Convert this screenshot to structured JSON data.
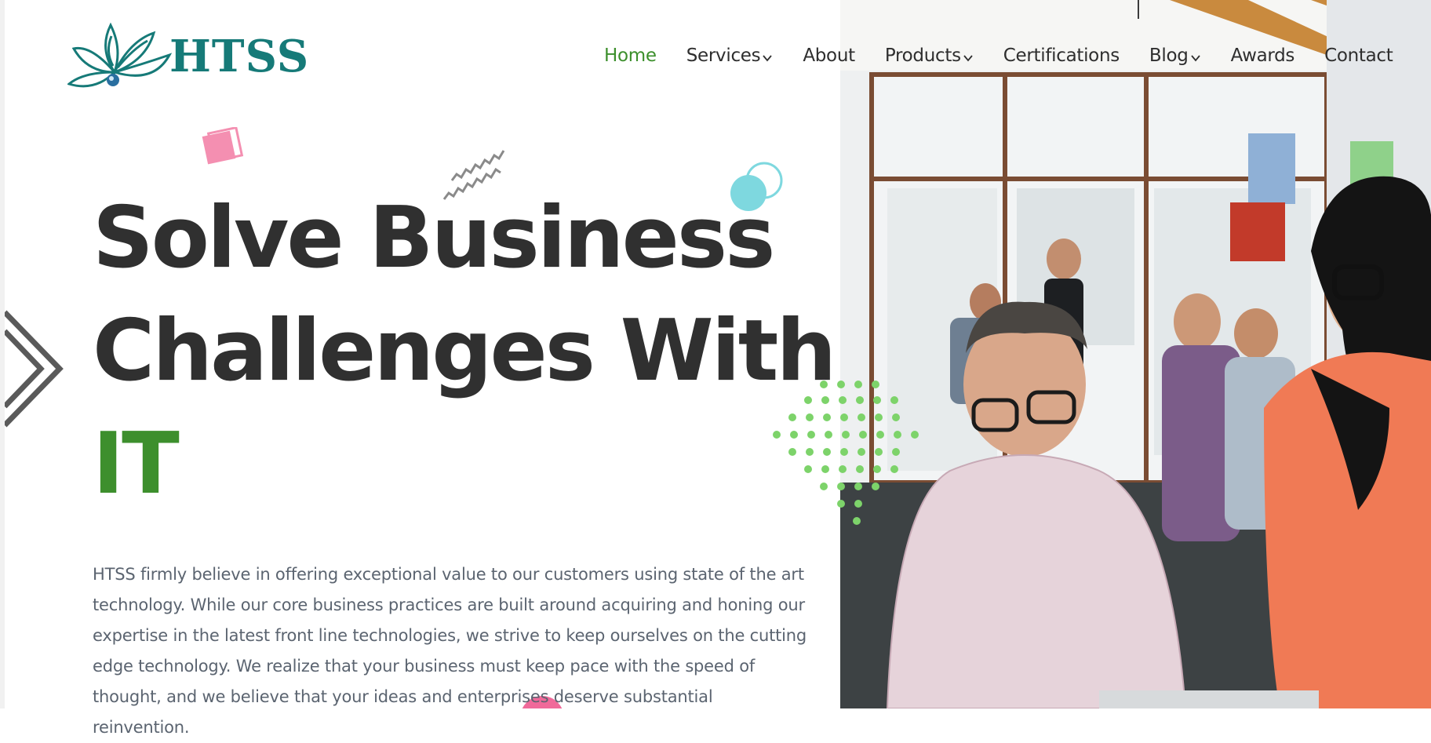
{
  "brand": {
    "name": "HTSS",
    "logo_icon": "lotus-logo-icon",
    "color": "#167a78"
  },
  "nav": {
    "items": [
      {
        "label": "Home",
        "active": true,
        "has_dropdown": false
      },
      {
        "label": "Services",
        "active": false,
        "has_dropdown": true
      },
      {
        "label": "About",
        "active": false,
        "has_dropdown": false
      },
      {
        "label": "Products",
        "active": false,
        "has_dropdown": true
      },
      {
        "label": "Certifications",
        "active": false,
        "has_dropdown": false
      },
      {
        "label": "Blog",
        "active": false,
        "has_dropdown": true
      },
      {
        "label": "Awards",
        "active": false,
        "has_dropdown": false
      },
      {
        "label": "Contact",
        "active": false,
        "has_dropdown": false
      }
    ],
    "active_color": "#3c8f2c",
    "dropdown_icon": "chevron-down-icon"
  },
  "hero": {
    "heading_line_1": "Solve Business",
    "heading_line_2": "Challenges With",
    "heading_accent": "IT",
    "accent_color": "#3d8f2d",
    "body": "HTSS firmly believe in offering exceptional value to our customers using state of the art technology. While our core business practices are built around acquiring and honing our expertise in the latest front line technologies, we strive to keep ourselves on the cutting edge technology. We realize that your business must keep pace with the speed of thought, and we believe that your ideas and enterprises deserve substantial reinvention.",
    "image": "office-team-photo"
  },
  "decorations": {
    "pink_squares": "#f48fb1",
    "teal_circles": "#7ed8df",
    "green_dots": "#7dd36a",
    "chevrons": "#5a5a5a"
  }
}
